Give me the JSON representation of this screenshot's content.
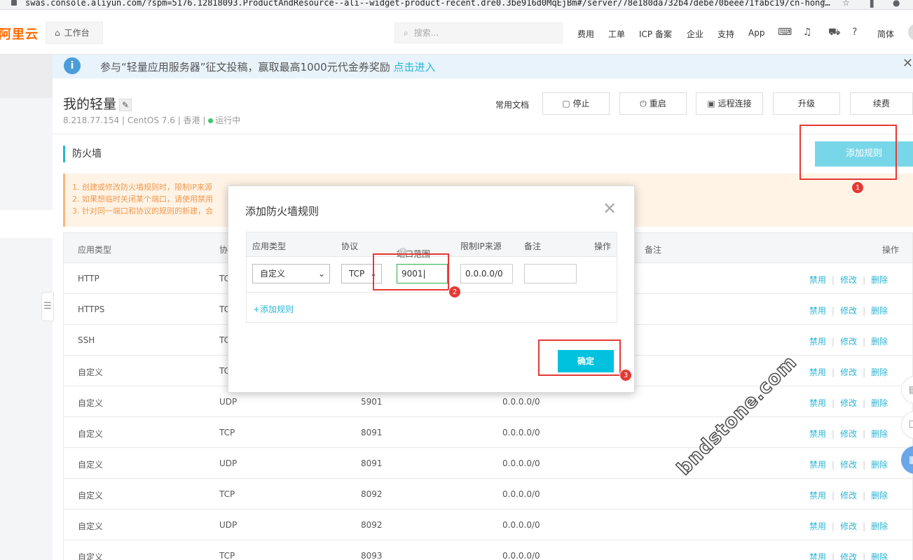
{
  "browser": {
    "url": "swas.console.aliyun.com/?spm=5176.12818093.ProductAndResource--ali--widget-product-recent.dre0.3be916d0MqEjBm#/server/78e180da732b47debe70beee71fabc19/cn-hong…"
  },
  "topnav": {
    "logo": "阿里云",
    "workbench": "工作台",
    "search_placeholder": "搜索...",
    "links": [
      "费用",
      "工单",
      "ICP 备案",
      "企业",
      "支持",
      "App"
    ],
    "lang": "简体"
  },
  "banner": {
    "text": "参与“轻量应用服务器”征文投稿，赢取最高1000元代金券奖励",
    "link": "点击进入"
  },
  "header": {
    "title": "我的轻量",
    "subtitle": "8.218.77.154 | CentOS 7.6 | 香港 |",
    "status": "运行中",
    "docs": "常用文档",
    "stop": "停止",
    "restart": "重启",
    "remote": "远程连接",
    "upgrade": "升级",
    "renew": "续费"
  },
  "section": {
    "title": "防火墙",
    "add_rule": "添加规则"
  },
  "notice": {
    "lines": [
      "1. 创建或修改防火墙规则时，限制IP来源",
      "2. 如果想临时关闭某个端口，请使用禁用",
      "3. 针对同一端口和协议的规则的新建，会"
    ]
  },
  "table": {
    "headers": {
      "app_type": "应用类型",
      "protocol": "协",
      "remark": "备注",
      "actions": "操作"
    },
    "actions": [
      "禁用",
      "修改",
      "删除"
    ],
    "rows": [
      {
        "app": "HTTP",
        "proto": "TC",
        "port": "",
        "ip": ""
      },
      {
        "app": "HTTPS",
        "proto": "TC",
        "port": "",
        "ip": ""
      },
      {
        "app": "SSH",
        "proto": "TC",
        "port": "",
        "ip": ""
      },
      {
        "app": "自定义",
        "proto": "TC",
        "port": "",
        "ip": ""
      },
      {
        "app": "自定义",
        "proto": "UDP",
        "port": "5901",
        "ip": "0.0.0.0/0"
      },
      {
        "app": "自定义",
        "proto": "TCP",
        "port": "8091",
        "ip": "0.0.0.0/0"
      },
      {
        "app": "自定义",
        "proto": "UDP",
        "port": "8091",
        "ip": "0.0.0.0/0"
      },
      {
        "app": "自定义",
        "proto": "TCP",
        "port": "8092",
        "ip": "0.0.0.0/0"
      },
      {
        "app": "自定义",
        "proto": "UDP",
        "port": "8092",
        "ip": "0.0.0.0/0"
      },
      {
        "app": "自定义",
        "proto": "TCP",
        "port": "8093",
        "ip": "0.0.0.0/0"
      }
    ]
  },
  "modal": {
    "title": "添加防火墙规则",
    "headers": {
      "app_type": "应用类型",
      "protocol": "协议",
      "port_range": "端口范围",
      "ip_source": "限制IP来源",
      "remark": "备注",
      "action": "操作"
    },
    "row": {
      "app_type": "自定义",
      "protocol": "TCP",
      "port": "9001",
      "ip": "0.0.0.0/0",
      "remark": ""
    },
    "add_rule": "+添加规则",
    "confirm": "确定"
  },
  "annotations": [
    "1",
    "2",
    "3"
  ],
  "watermark": "bndstone.com",
  "colors": {
    "accent": "#00c1de",
    "brand": "#ff6a00",
    "annotation": "#e53935"
  }
}
